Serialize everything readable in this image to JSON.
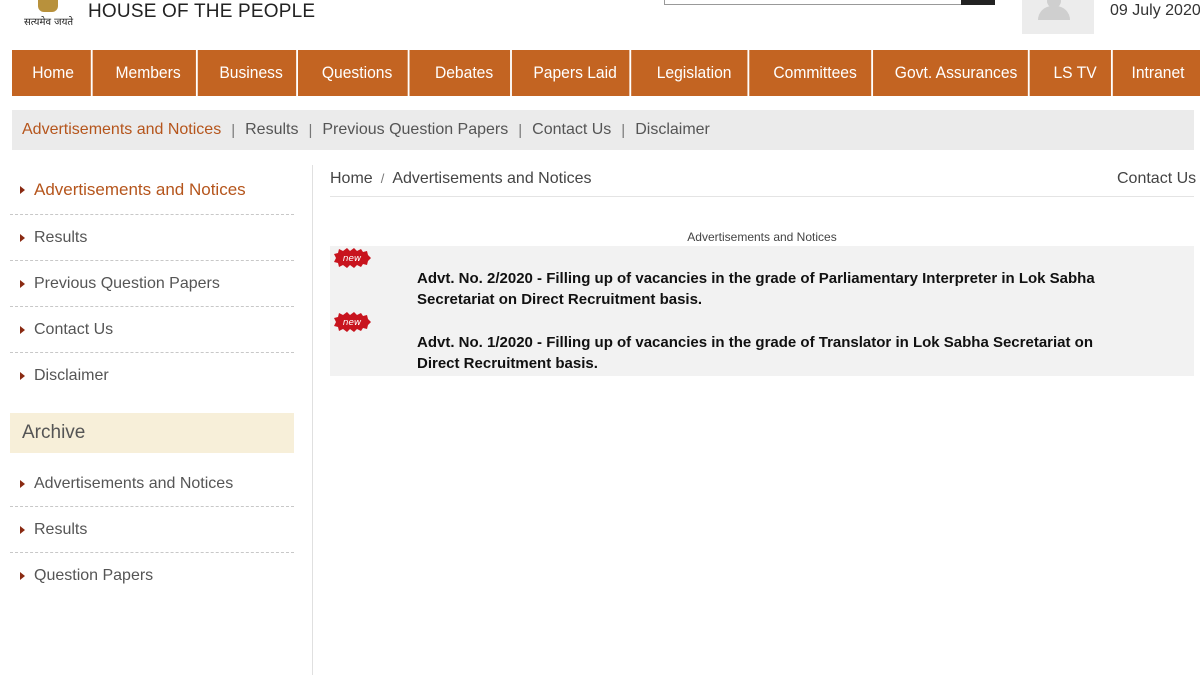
{
  "header": {
    "emblem_motto": "सत्यमेव जयते",
    "site_title": "HOUSE OF THE PEOPLE",
    "date": "09 July 2020"
  },
  "main_nav": {
    "items": [
      {
        "label": "Home",
        "width": 84
      },
      {
        "label": "Members",
        "width": 106
      },
      {
        "label": "Business",
        "width": 100
      },
      {
        "label": "Questions",
        "width": 112
      },
      {
        "label": "Debates",
        "width": 102
      },
      {
        "label": "Papers Laid",
        "width": 120
      },
      {
        "label": "Legislation",
        "width": 118
      },
      {
        "label": "Committees",
        "width": 124
      },
      {
        "label": "Govt. Assurances",
        "width": 158
      },
      {
        "label": "LS TV",
        "width": 80
      },
      {
        "label": "Intranet",
        "width": 84
      }
    ]
  },
  "sub_nav": {
    "items": [
      {
        "label": "Advertisements and Notices",
        "active": true
      },
      {
        "label": "Results",
        "active": false
      },
      {
        "label": "Previous Question Papers",
        "active": false
      },
      {
        "label": "Contact Us",
        "active": false
      },
      {
        "label": "Disclaimer",
        "active": false
      }
    ]
  },
  "sidebar": {
    "primary": [
      "Advertisements and Notices",
      "Results",
      "Previous Question Papers",
      "Contact Us",
      "Disclaimer"
    ],
    "archive_title": "Archive",
    "archive": [
      "Advertisements and Notices",
      "Results",
      "Question Papers"
    ]
  },
  "content": {
    "breadcrumb_home": "Home",
    "breadcrumb_sep": "/",
    "breadcrumb_current": "Advertisements and Notices",
    "contact_link": "Contact Us",
    "section_caption": "Advertisements and Notices",
    "new_badge": "new",
    "notices": [
      "Advt. No. 2/2020 - Filling up of vacancies in the grade of Parliamentary Interpreter in Lok Sabha Secretariat on Direct Recruitment basis.",
      "Advt. No. 1/2020 - Filling up of vacancies in the grade of Translator in Lok Sabha Secretariat on Direct Recruitment basis."
    ]
  },
  "colors": {
    "nav_bg": "#c36422",
    "active_link": "#b5551c",
    "subnav_bg": "#ebebeb",
    "archive_bg": "#f7efd9",
    "new_badge": "#c8141e"
  },
  "icons": {
    "emblem": "national-emblem-icon",
    "user": "user-avatar-icon",
    "search": "search-icon",
    "bullet": "caret-right-icon",
    "new": "new-badge-icon"
  }
}
